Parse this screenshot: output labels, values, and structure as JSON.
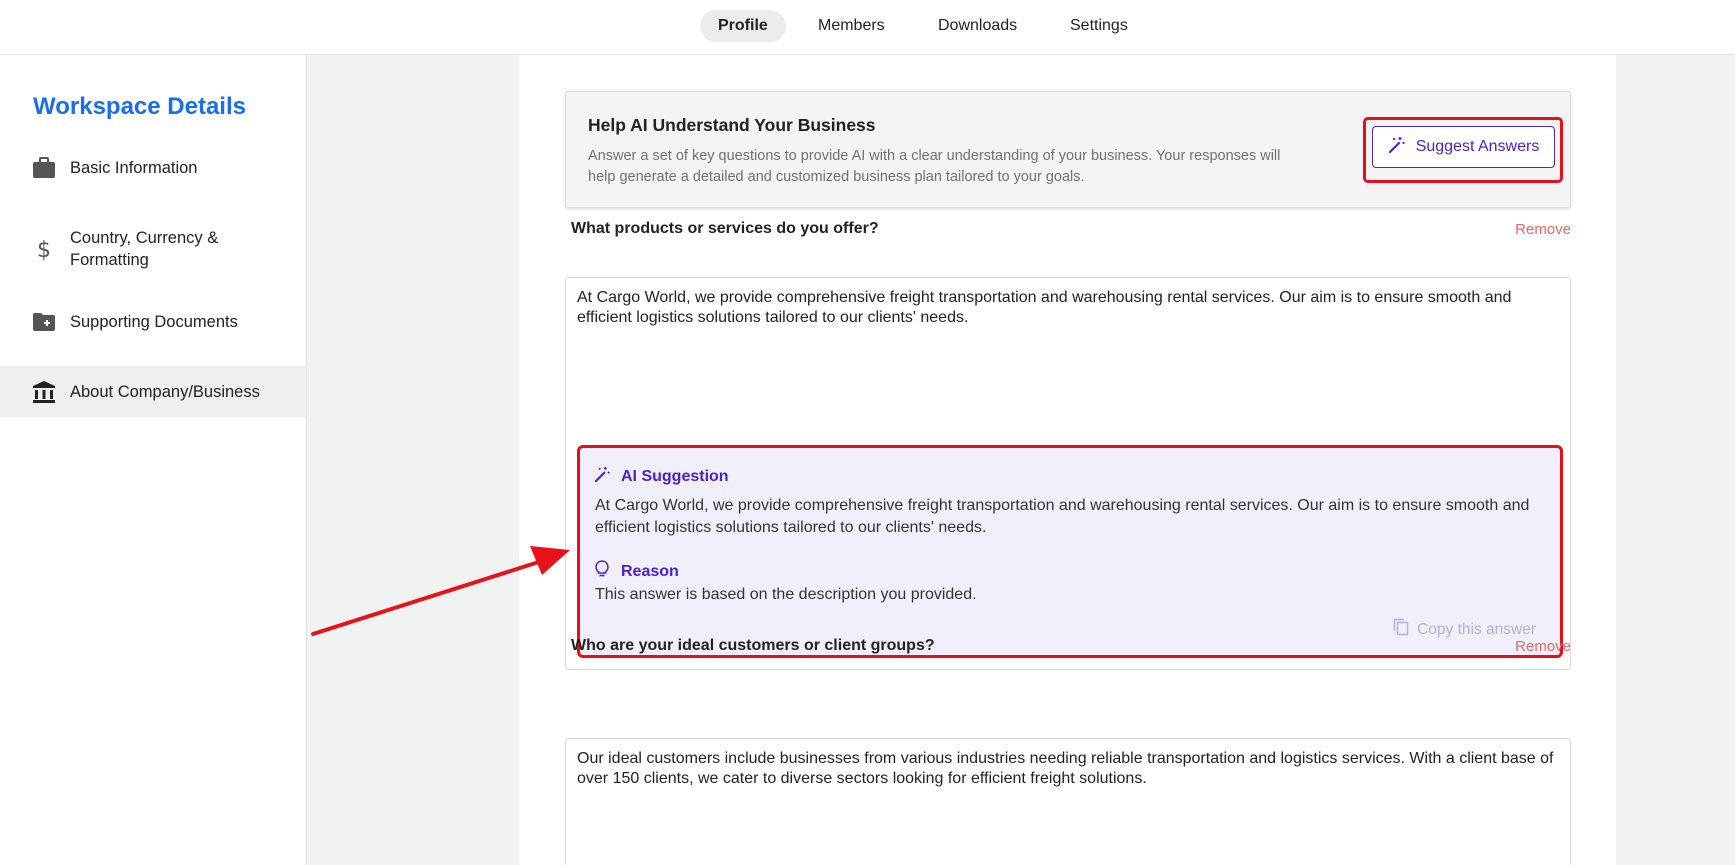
{
  "tabs": [
    {
      "label": "Profile",
      "active": true
    },
    {
      "label": "Members",
      "active": false
    },
    {
      "label": "Downloads",
      "active": false
    },
    {
      "label": "Settings",
      "active": false
    }
  ],
  "sidebar": {
    "title": "Workspace Details",
    "items": [
      {
        "label": "Basic Information",
        "icon": "briefcase-icon"
      },
      {
        "label": "Country, Currency & Formatting",
        "icon": "dollar-icon"
      },
      {
        "label": "Supporting Documents",
        "icon": "folder-plus-icon"
      },
      {
        "label": "About Company/Business",
        "icon": "bank-icon",
        "active": true
      }
    ]
  },
  "help": {
    "title": "Help AI Understand Your Business",
    "description": "Answer a set of key questions to provide AI with a clear understanding of your business. Your responses will help generate a detailed and customized business plan tailored to your goals.",
    "suggest_label": "Suggest Answers"
  },
  "questions": [
    {
      "label": "What products or services do you offer?",
      "remove_label": "Remove",
      "answer": "At Cargo World, we provide comprehensive freight transportation and warehousing rental services. Our aim is to ensure smooth and efficient logistics solutions tailored to our clients' needs."
    },
    {
      "label": "Who are your ideal customers or client groups?",
      "remove_label": "Remove",
      "answer": "Our ideal customers include businesses from various industries needing reliable transportation and logistics services. With a client base of over 150 clients, we cater to diverse sectors looking for efficient freight solutions."
    }
  ],
  "ai_suggestion": {
    "title": "AI Suggestion",
    "text": "At Cargo World, we provide comprehensive freight transportation and warehousing rental services. Our aim is to ensure smooth and efficient logistics solutions tailored to our clients' needs.",
    "reason_title": "Reason",
    "reason_text": "This answer is based on the description you provided.",
    "copy_label": "Copy this answer"
  },
  "colors": {
    "accent": "#4a22c8",
    "brand_blue": "#1a6ee8",
    "highlight_red": "#e3111b",
    "remove": "#e46b65"
  }
}
